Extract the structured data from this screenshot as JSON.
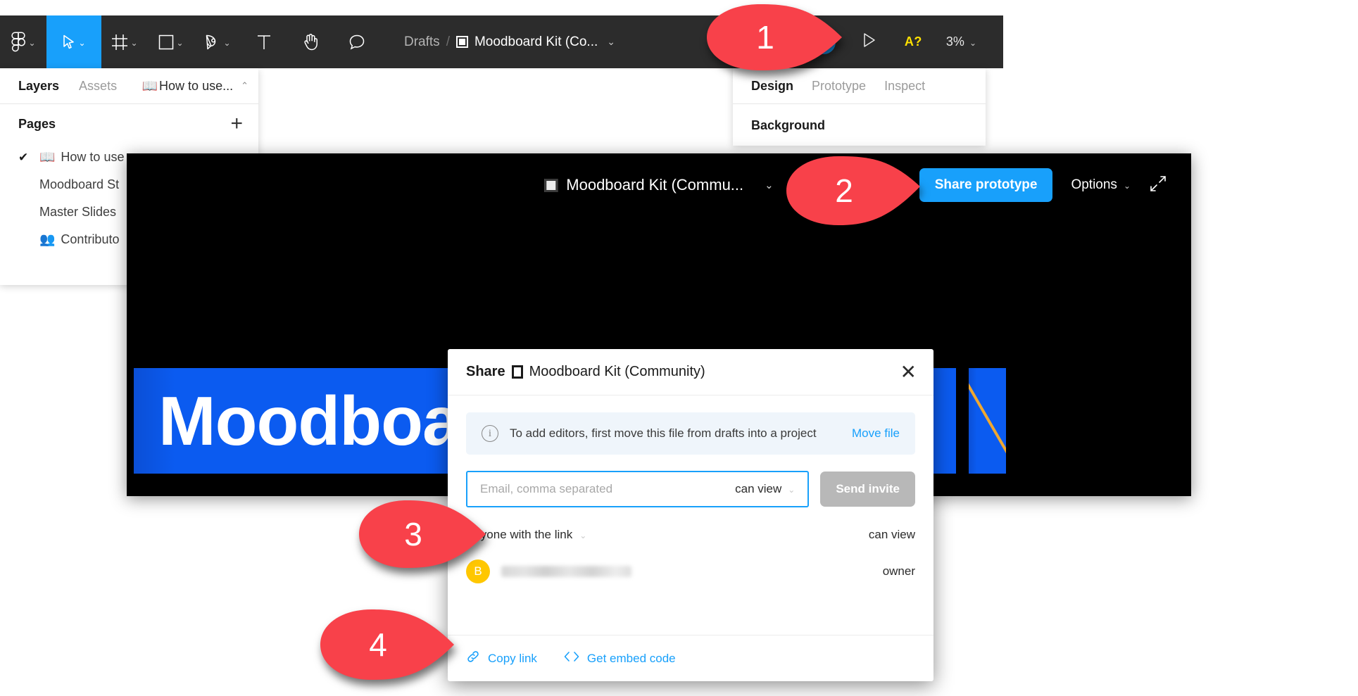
{
  "app": {
    "name": "Figma",
    "accent_blue": "#18a0fb",
    "callout_red": "#f8414a"
  },
  "toolbar": {
    "tools": [
      {
        "name": "figma-menu",
        "icon": "figma-logo-icon",
        "caret": "⌄"
      },
      {
        "name": "move",
        "icon": "cursor-arrow-icon",
        "caret": "⌄",
        "active": true
      },
      {
        "name": "frame",
        "icon": "frame-icon",
        "caret": "⌄"
      },
      {
        "name": "shape",
        "icon": "rectangle-icon",
        "caret": "⌄"
      },
      {
        "name": "pen",
        "icon": "pen-icon",
        "caret": "⌄"
      },
      {
        "name": "text",
        "icon": "text-t-icon",
        "caret": ""
      },
      {
        "name": "hand",
        "icon": "hand-icon",
        "caret": ""
      },
      {
        "name": "comment",
        "icon": "comment-bubble-icon",
        "caret": ""
      }
    ],
    "breadcrumb": {
      "root": "Drafts",
      "separator": "/",
      "file_name": "Moodboard Kit (Co...",
      "caret": "⌄"
    },
    "right": {
      "present_icon": "play-triangle-icon",
      "alert_label": "A?",
      "zoom_level": "3%",
      "zoom_caret": "⌄"
    }
  },
  "left_panel": {
    "tabs": [
      {
        "label": "Layers",
        "active": true
      },
      {
        "label": "Assets",
        "active": false
      }
    ],
    "file_selector": {
      "icon": "open-book-icon",
      "label": "How to use...",
      "caret": "⌃"
    },
    "pages_header": "Pages",
    "add_page_label": "+",
    "pages": [
      {
        "label": "How to use",
        "icon": "open-book-icon",
        "selected": true
      },
      {
        "label": "Moodboard St",
        "icon": "",
        "selected": false
      },
      {
        "label": "Master Slides",
        "icon": "",
        "selected": false
      },
      {
        "label": "Contributo",
        "icon": "people-icon",
        "selected": false
      }
    ]
  },
  "right_panel": {
    "tabs": [
      {
        "label": "Design",
        "active": true
      },
      {
        "label": "Prototype",
        "active": false
      },
      {
        "label": "Inspect",
        "active": false
      }
    ],
    "section_title": "Background"
  },
  "prototype_window": {
    "title": "Moodboard Kit (Commu...",
    "title_caret": "⌄",
    "share_button": "Share prototype",
    "options_button": "Options",
    "options_caret": "⌄",
    "fullscreen_icon": "expand-arrows-icon",
    "canvas": {
      "banner_text": "Moodboa",
      "banner_color": "#0b5bf0",
      "accent_line_color": "#f0a830"
    }
  },
  "share_modal": {
    "title_prefix": "Share",
    "title_file": "Moodboard Kit (Community)",
    "close_icon": "close-x-icon",
    "notice": {
      "icon": "info-circle-icon",
      "text": "To add editors, first move this file from drafts into a project",
      "action": "Move file"
    },
    "invite": {
      "placeholder": "Email, comma separated",
      "value": "",
      "permission": "can view",
      "permission_caret": "⌄",
      "send_button": "Send invite"
    },
    "link_access": {
      "label": "Anyone with the link",
      "caret": "⌄",
      "permission": "can view"
    },
    "person": {
      "avatar_initial": "B",
      "avatar_color": "#ffc700",
      "name": "",
      "role": "owner"
    },
    "footer": [
      {
        "label": "Copy link",
        "icon": "link-chain-icon"
      },
      {
        "label": "Get embed code",
        "icon": "code-brackets-icon"
      }
    ]
  },
  "callouts": [
    {
      "number": "1",
      "target": "present-button"
    },
    {
      "number": "2",
      "target": "share-prototype-button"
    },
    {
      "number": "3",
      "target": "anyone-with-the-link"
    },
    {
      "number": "4",
      "target": "copy-link"
    }
  ]
}
